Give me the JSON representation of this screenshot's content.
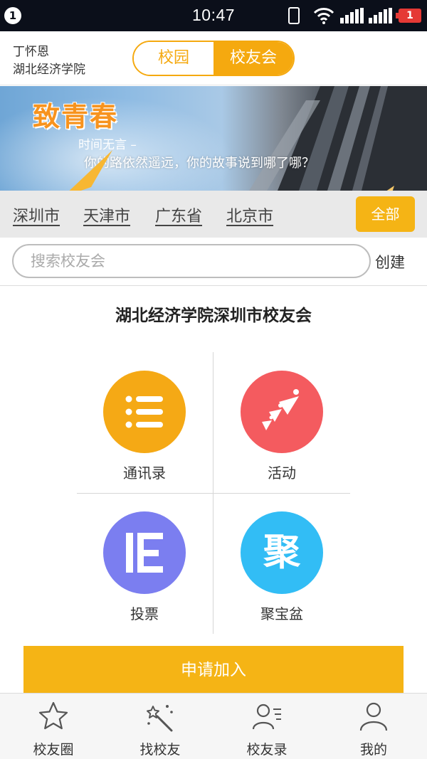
{
  "status_bar": {
    "notification_count": "1",
    "time": "10:47",
    "battery_level": "1",
    "icons": [
      "vibrate-icon",
      "wifi-icon",
      "signal-1-icon",
      "signal-2-icon",
      "battery-icon"
    ]
  },
  "header": {
    "user_name": "丁怀恩",
    "school": "湖北经济学院",
    "segments": [
      "校园",
      "校友会"
    ],
    "active_segment": "校友会"
  },
  "banner": {
    "title": "致青春",
    "line1": "时间无言 –",
    "line2": "你的路依然遥远，你的故事说到哪了哪？"
  },
  "cities": {
    "items": [
      "深圳市",
      "天津市",
      "广东省",
      "北京市"
    ],
    "all_label": "全部"
  },
  "search": {
    "placeholder": "搜索校友会",
    "value": "",
    "create_label": "创建"
  },
  "club": {
    "title": "湖北经济学院深圳市校友会"
  },
  "features": [
    {
      "label": "通讯录",
      "icon": "list-icon",
      "color": "#f5a915"
    },
    {
      "label": "活动",
      "icon": "activity-people-icon",
      "color": "#f45b5f"
    },
    {
      "label": "投票",
      "icon": "vote-icon",
      "color": "#7b7ef0"
    },
    {
      "label": "聚宝盆",
      "icon": "treasure-ju-icon",
      "color": "#32bdf5",
      "icon_text": "聚"
    }
  ],
  "join_label": "申请加入",
  "bottom_nav": [
    {
      "label": "校友圈",
      "icon": "star-icon"
    },
    {
      "label": "找校友",
      "icon": "magic-wand-icon"
    },
    {
      "label": "校友录",
      "icon": "contacts-icon"
    },
    {
      "label": "我的",
      "icon": "person-icon"
    }
  ]
}
